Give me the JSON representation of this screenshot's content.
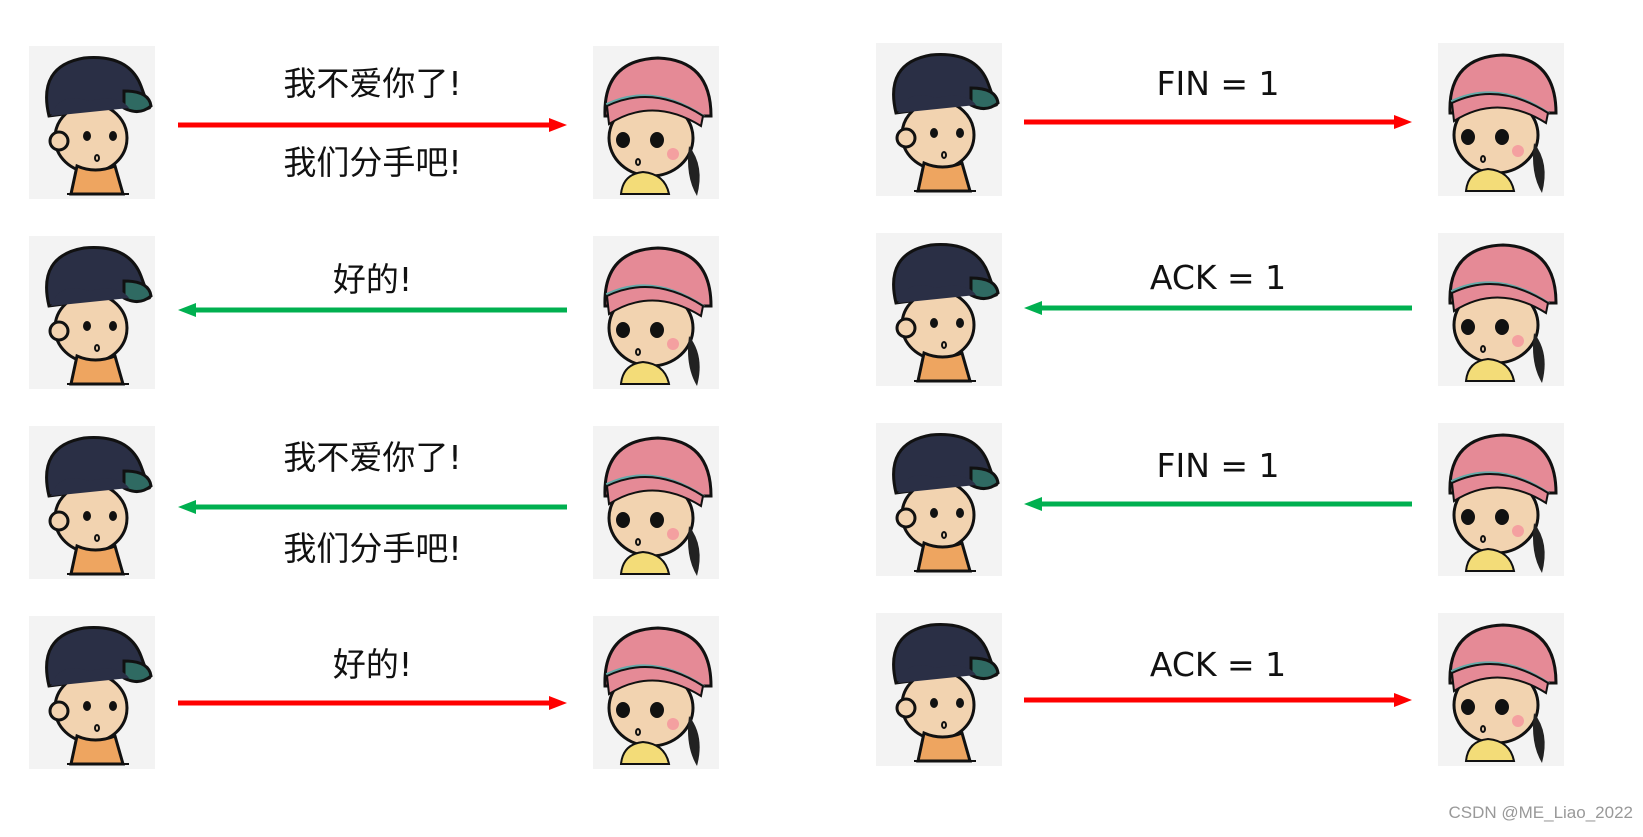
{
  "colors": {
    "forward_arrow": "#ff0000",
    "reverse_arrow": "#00b050"
  },
  "left_panel": {
    "rows": [
      {
        "direction": "right",
        "top_text": "我不爱你了!",
        "bottom_text": "我们分手吧!"
      },
      {
        "direction": "left",
        "top_text": "好的!"
      },
      {
        "direction": "left",
        "top_text": "我不爱你了!",
        "bottom_text": "我们分手吧!"
      },
      {
        "direction": "right",
        "top_text": "好的!"
      }
    ]
  },
  "right_panel": {
    "rows": [
      {
        "direction": "right",
        "top_text": "FIN = 1"
      },
      {
        "direction": "left",
        "top_text": "ACK = 1"
      },
      {
        "direction": "left",
        "top_text": "FIN = 1"
      },
      {
        "direction": "right",
        "top_text": "ACK = 1"
      }
    ]
  },
  "characters": {
    "left": "boy-cartoon",
    "right": "girl-cartoon"
  },
  "watermark": "CSDN @ME_Liao_2022"
}
